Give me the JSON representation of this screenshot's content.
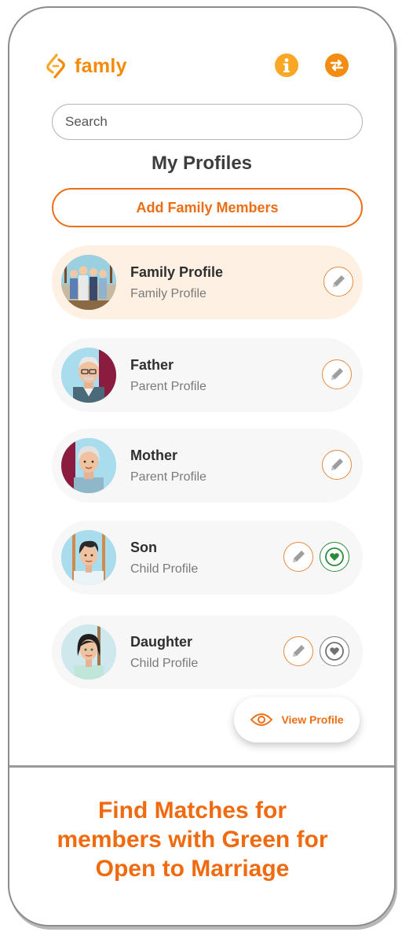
{
  "app": {
    "name": "famly"
  },
  "header": {
    "info_icon": "info-icon",
    "swap_icon": "swap-icon",
    "accent": "#f58a07"
  },
  "search": {
    "placeholder": "Search",
    "value": ""
  },
  "page": {
    "title": "My Profiles",
    "add_button": "Add Family Members"
  },
  "profiles": [
    {
      "name": "Family Profile",
      "type": "Family Profile",
      "highlighted": true,
      "heart": null
    },
    {
      "name": "Father",
      "type": "Parent Profile",
      "highlighted": false,
      "heart": null
    },
    {
      "name": "Mother",
      "type": "Parent Profile",
      "highlighted": false,
      "heart": null
    },
    {
      "name": "Son",
      "type": "Child Profile",
      "highlighted": false,
      "heart": "green"
    },
    {
      "name": "Daughter",
      "type": "Child Profile",
      "highlighted": false,
      "heart": "gray"
    }
  ],
  "view_profile": {
    "label": "View Profile",
    "icon": "eye-icon"
  },
  "caption": {
    "line1": "Find Matches for",
    "line2": "members with Green for",
    "line3": "Open to Marriage"
  },
  "colors": {
    "orange": "#ec6e14",
    "open_to_marriage": "#2a8c3a",
    "highlight_bg": "#fef1e3"
  }
}
